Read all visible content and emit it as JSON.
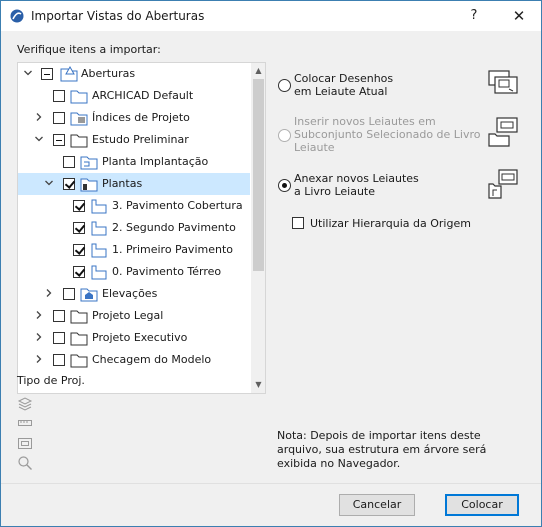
{
  "window": {
    "title": "Importar Vistas do Aberturas",
    "help_glyph": "?",
    "close_glyph": "✕"
  },
  "tree": {
    "heading": "Verifique itens a importar:",
    "items": [
      {
        "label": "Aberturas",
        "icon": "project-folder-icon",
        "check": "partial",
        "chevron": "down"
      },
      {
        "label": "ARCHICAD Default",
        "icon": "folder-icon",
        "check": "unchecked",
        "chevron": "none"
      },
      {
        "label": "Índices de Projeto",
        "icon": "index-folder-icon",
        "check": "unchecked",
        "chevron": "right"
      },
      {
        "label": "Estudo Preliminar",
        "icon": "folder-icon",
        "check": "partial",
        "chevron": "down"
      },
      {
        "label": "Planta Implantação",
        "icon": "floorplan-folder-icon",
        "check": "unchecked",
        "chevron": "none"
      },
      {
        "label": "Plantas",
        "icon": "floorplan-folder-icon",
        "check": "checked",
        "chevron": "down",
        "selected": true
      },
      {
        "label": "3. Pavimento Cobertura",
        "icon": "floorplan-icon",
        "check": "checked",
        "chevron": "none"
      },
      {
        "label": "2. Segundo Pavimento",
        "icon": "floorplan-icon",
        "check": "checked",
        "chevron": "none"
      },
      {
        "label": "1. Primeiro Pavimento",
        "icon": "floorplan-icon",
        "check": "checked",
        "chevron": "none"
      },
      {
        "label": "0. Pavimento Térreo",
        "icon": "floorplan-icon",
        "check": "checked",
        "chevron": "none"
      },
      {
        "label": "Elevações",
        "icon": "elevation-folder-icon",
        "check": "unchecked",
        "chevron": "right"
      },
      {
        "label": "Projeto Legal",
        "icon": "folder-icon",
        "check": "unchecked",
        "chevron": "right"
      },
      {
        "label": "Projeto Executivo",
        "icon": "folder-icon",
        "check": "unchecked",
        "chevron": "right"
      },
      {
        "label": "Checagem do Modelo",
        "icon": "folder-icon",
        "check": "unchecked",
        "chevron": "right"
      }
    ]
  },
  "projection": {
    "label": "Tipo de Proj.",
    "icons": [
      "layers-icon",
      "ruler-icon",
      "layout-icon",
      "search-icon"
    ]
  },
  "options": {
    "place_drawings": "Colocar Desenhos\nem Leiaute Atual",
    "insert_layouts": "Inserir novos Leiautes em\nSubconjunto Selecionado de Livro\nLeiaute",
    "append_layouts": "Anexar novos Leiautes\na Livro Leiaute",
    "use_hierarchy": "Utilizar Hierarquia da Origem",
    "selected": "append_layouts"
  },
  "note": "Nota: Depois de importar itens deste arquivo, sua estrutura em árvore será exibida no Navegador.",
  "buttons": {
    "cancel": "Cancelar",
    "place": "Colocar"
  }
}
